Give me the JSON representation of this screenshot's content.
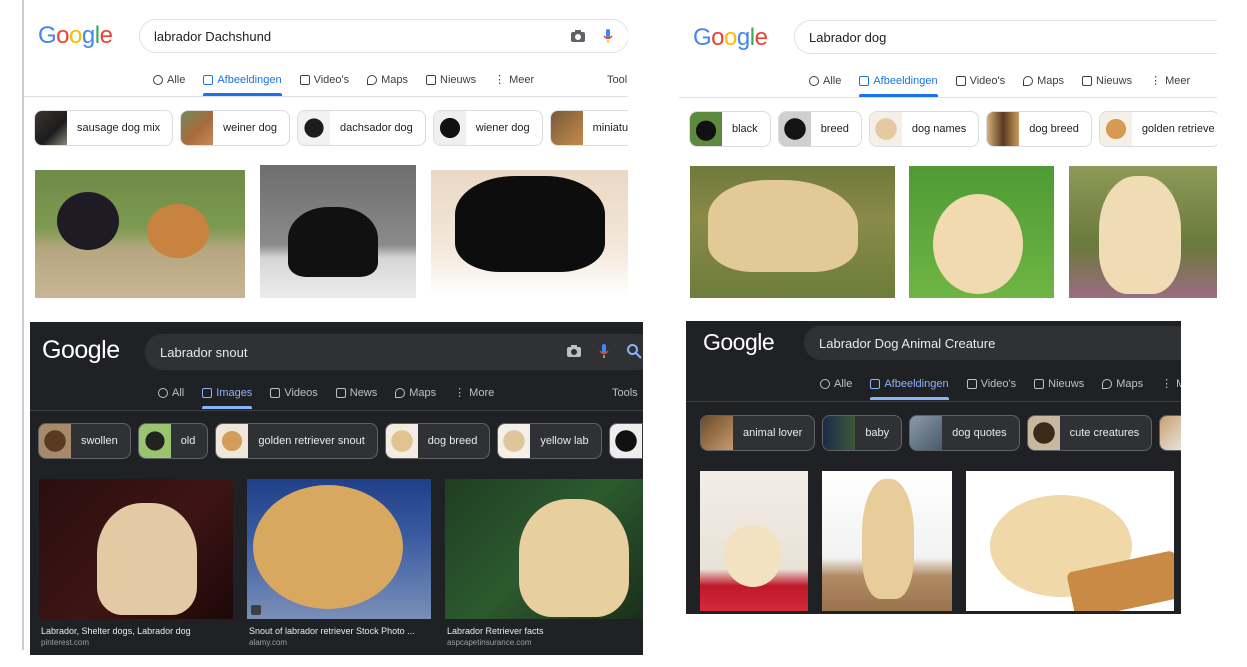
{
  "panels": [
    {
      "theme": "light",
      "query": "labrador Dachshund",
      "tabs": [
        {
          "label": "Alle",
          "icon": "search-icon",
          "active": false
        },
        {
          "label": "Afbeeldingen",
          "icon": "image-icon",
          "active": true
        },
        {
          "label": "Video's",
          "icon": "video-icon",
          "active": false
        },
        {
          "label": "Maps",
          "icon": "map-pin-icon",
          "active": false
        },
        {
          "label": "Nieuws",
          "icon": "news-icon",
          "active": false
        },
        {
          "label": "Meer",
          "icon": "more-icon",
          "active": false
        }
      ],
      "tools_label": "Tool",
      "chips": [
        "sausage dog mix",
        "weiner dog",
        "dachsador dog",
        "wiener dog",
        "miniatu"
      ]
    },
    {
      "theme": "light",
      "query": "Labrador dog",
      "tabs": [
        {
          "label": "Alle",
          "icon": "search-icon",
          "active": false
        },
        {
          "label": "Afbeeldingen",
          "icon": "image-icon",
          "active": true
        },
        {
          "label": "Video's",
          "icon": "video-icon",
          "active": false
        },
        {
          "label": "Maps",
          "icon": "map-pin-icon",
          "active": false
        },
        {
          "label": "Nieuws",
          "icon": "news-icon",
          "active": false
        },
        {
          "label": "Meer",
          "icon": "more-icon",
          "active": false
        }
      ],
      "chips": [
        "black",
        "breed",
        "dog names",
        "dog breed",
        "golden retrieve"
      ]
    },
    {
      "theme": "dark",
      "query": "Labrador snout",
      "tabs": [
        {
          "label": "All",
          "icon": "search-icon",
          "active": false
        },
        {
          "label": "Images",
          "icon": "image-icon",
          "active": true
        },
        {
          "label": "Videos",
          "icon": "video-icon",
          "active": false
        },
        {
          "label": "News",
          "icon": "news-icon",
          "active": false
        },
        {
          "label": "Maps",
          "icon": "map-pin-icon",
          "active": false
        },
        {
          "label": "More",
          "icon": "more-icon",
          "active": false
        }
      ],
      "tools_label": "Tools",
      "chips": [
        "swollen",
        "old",
        "golden retriever snout",
        "dog breed",
        "yellow lab"
      ],
      "captions": [
        {
          "title": "Labrador, Shelter dogs, Labrador dog",
          "source": "pinterest.com"
        },
        {
          "title": "Snout of labrador retriever Stock Photo ...",
          "source": "alamy.com"
        },
        {
          "title": "Labrador Retriever facts",
          "source": "aspcapetinsurance.com"
        }
      ]
    },
    {
      "theme": "dark",
      "query": "Labrador Dog Animal Creature",
      "tabs": [
        {
          "label": "Alle",
          "icon": "search-icon",
          "active": false
        },
        {
          "label": "Afbeeldingen",
          "icon": "image-icon",
          "active": true
        },
        {
          "label": "Video's",
          "icon": "video-icon",
          "active": false
        },
        {
          "label": "Nieuws",
          "icon": "news-icon",
          "active": false
        },
        {
          "label": "Maps",
          "icon": "map-pin-icon",
          "active": false
        },
        {
          "label": "M",
          "icon": "more-icon",
          "active": false
        }
      ],
      "chips": [
        "animal lover",
        "baby",
        "dog quotes",
        "cute creatures"
      ]
    }
  ],
  "logo_text": "Google",
  "colors": {
    "google_blue": "#4285f4",
    "google_red": "#ea4335",
    "google_yellow": "#fbbc05",
    "google_green": "#34a853",
    "active_light": "#1a73e8",
    "active_dark": "#8ab4f8",
    "dark_bg": "#202124"
  }
}
